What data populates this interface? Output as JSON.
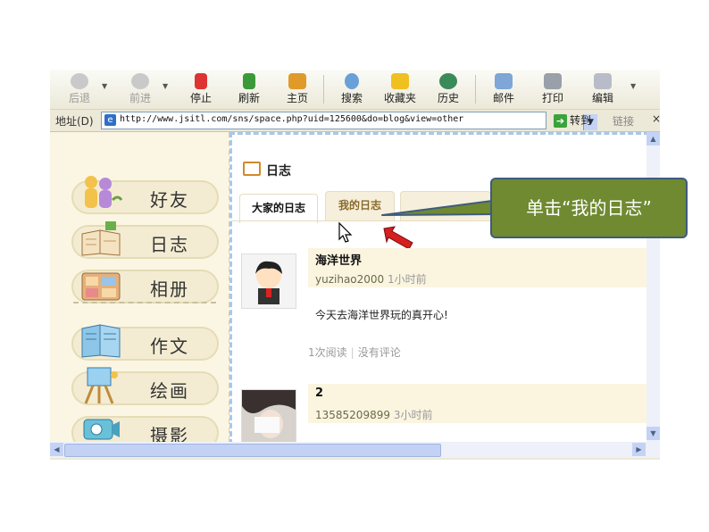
{
  "toolbar": {
    "back": "后退",
    "forward": "前进",
    "stop": "停止",
    "refresh": "刷新",
    "home": "主页",
    "search": "搜索",
    "favorites": "收藏夹",
    "history": "历史",
    "mail": "邮件",
    "print": "打印",
    "edit": "编辑"
  },
  "address": {
    "label": "地址(D)",
    "url": "http://www.jsitl.com/sns/space.php?uid=125600&do=blog&view=other",
    "go": "转到",
    "links": "链接",
    "close": "×"
  },
  "sidebar": {
    "items": [
      {
        "label": "好友",
        "icon": "friends-icon"
      },
      {
        "label": "日志",
        "icon": "journal-icon"
      },
      {
        "label": "相册",
        "icon": "album-icon"
      },
      {
        "label": "作文",
        "icon": "essay-icon"
      },
      {
        "label": "绘画",
        "icon": "painting-icon"
      },
      {
        "label": "摄影",
        "icon": "camera-icon"
      }
    ]
  },
  "main": {
    "title": "日志",
    "tabs": [
      {
        "label": "大家的日志"
      },
      {
        "label": "我的日志"
      }
    ],
    "entries": [
      {
        "title": "海洋世界",
        "author": "yuzihao2000",
        "time": "1小时前",
        "body": "今天去海洋世界玩的真开心!",
        "reads": "1次阅读",
        "comments": "没有评论"
      },
      {
        "title": "2",
        "author": "13585209899",
        "time": "3小时前"
      }
    ]
  },
  "callout": {
    "text": "单击“我的日志”"
  },
  "colors": {
    "callout_bg": "#6f8a31",
    "pointer": "#d42020",
    "tab_active_text": "#8a6a2a"
  }
}
